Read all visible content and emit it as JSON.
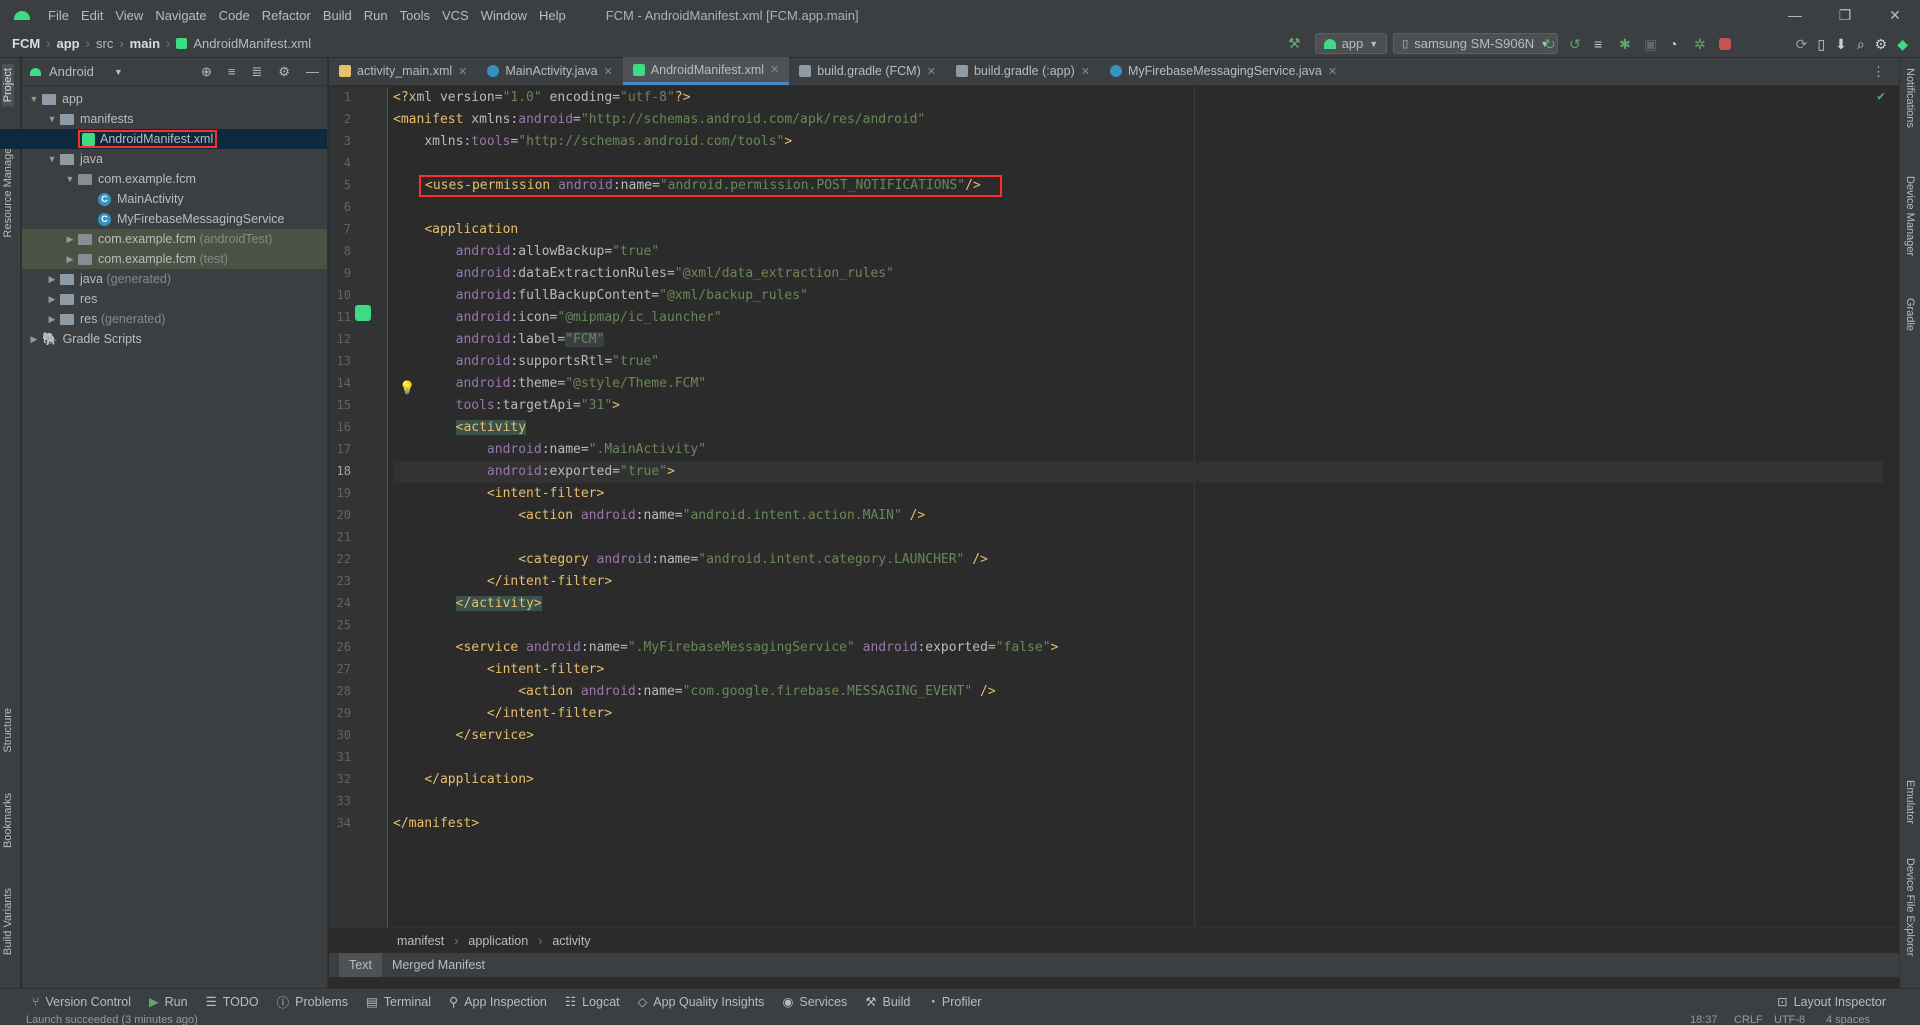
{
  "window": {
    "title": "FCM - AndroidManifest.xml [FCM.app.main]",
    "minimize": "—",
    "maximize": "❐",
    "close": "✕"
  },
  "menu": [
    "File",
    "Edit",
    "View",
    "Navigate",
    "Code",
    "Refactor",
    "Build",
    "Run",
    "Tools",
    "VCS",
    "Window",
    "Help"
  ],
  "breadcrumb": [
    "FCM",
    "app",
    "src",
    "main",
    "AndroidManifest.xml"
  ],
  "run_config": {
    "module": "app",
    "device": "samsung SM-S906N"
  },
  "project": {
    "view": "Android",
    "tree": [
      {
        "label": "app",
        "depth": 0,
        "icon": "folder",
        "open": true
      },
      {
        "label": "manifests",
        "depth": 1,
        "icon": "folder",
        "open": true
      },
      {
        "label": "AndroidManifest.xml",
        "depth": 2,
        "icon": "manifest",
        "selected": true
      },
      {
        "label": "java",
        "depth": 1,
        "icon": "folder",
        "open": true
      },
      {
        "label": "com.example.fcm",
        "depth": 2,
        "icon": "package",
        "open": true
      },
      {
        "label": "MainActivity",
        "depth": 3,
        "icon": "class"
      },
      {
        "label": "MyFirebaseMessagingService",
        "depth": 3,
        "icon": "class"
      },
      {
        "label": "com.example.fcm",
        "suffix": "(androidTest)",
        "depth": 2,
        "icon": "package",
        "collapsed": true,
        "highlight": true
      },
      {
        "label": "com.example.fcm",
        "suffix": "(test)",
        "depth": 2,
        "icon": "package",
        "collapsed": true,
        "highlight": true
      },
      {
        "label": "java",
        "suffix": "(generated)",
        "depth": 1,
        "icon": "folder",
        "collapsed": true
      },
      {
        "label": "res",
        "depth": 1,
        "icon": "folder",
        "collapsed": true
      },
      {
        "label": "res",
        "suffix": "(generated)",
        "depth": 1,
        "icon": "folder",
        "collapsed": true
      },
      {
        "label": "Gradle Scripts",
        "depth": 0,
        "icon": "gradle",
        "collapsed": true
      }
    ]
  },
  "left_strip": {
    "project": "Project",
    "resource_manager": "Resource Manager",
    "structure": "Structure",
    "bookmarks": "Bookmarks",
    "build_variants": "Build Variants"
  },
  "right_strip": {
    "notifications": "Notifications",
    "device_manager": "Device Manager",
    "gradle": "Gradle",
    "emulator": "Emulator",
    "device_file_explorer": "Device File Explorer"
  },
  "tabs": [
    {
      "label": "activity_main.xml",
      "color": "#e8bf6a"
    },
    {
      "label": "MainActivity.java",
      "color": "#3592c4"
    },
    {
      "label": "AndroidManifest.xml",
      "color": "#3ddc84",
      "active": true
    },
    {
      "label": "build.gradle (FCM)",
      "color": "#8e9ba4"
    },
    {
      "label": "build.gradle (:app)",
      "color": "#8e9ba4"
    },
    {
      "label": "MyFirebaseMessagingService.java",
      "color": "#3592c4"
    }
  ],
  "code_lines": [
    "1",
    "2",
    "3",
    "4",
    "5",
    "6",
    "7",
    "8",
    "9",
    "10",
    "11",
    "12",
    "13",
    "14",
    "15",
    "16",
    "17",
    "18",
    "19",
    "20",
    "21",
    "22",
    "23",
    "24",
    "25",
    "26",
    "27",
    "28",
    "29",
    "30",
    "31",
    "32",
    "33",
    "34"
  ],
  "editor_breadcrumb": [
    "manifest",
    "application",
    "activity"
  ],
  "editor_subtabs": [
    "Text",
    "Merged Manifest"
  ],
  "bottom_tools": [
    "Version Control",
    "Run",
    "TODO",
    "Problems",
    "Terminal",
    "App Inspection",
    "Logcat",
    "App Quality Insights",
    "Services",
    "Build",
    "Profiler"
  ],
  "layout_inspector": "Layout Inspector",
  "status": {
    "message": "Launch succeeded (3 minutes ago)",
    "position": "18:37",
    "line_sep": "CRLF",
    "encoding": "UTF-8",
    "indent": "4 spaces"
  }
}
